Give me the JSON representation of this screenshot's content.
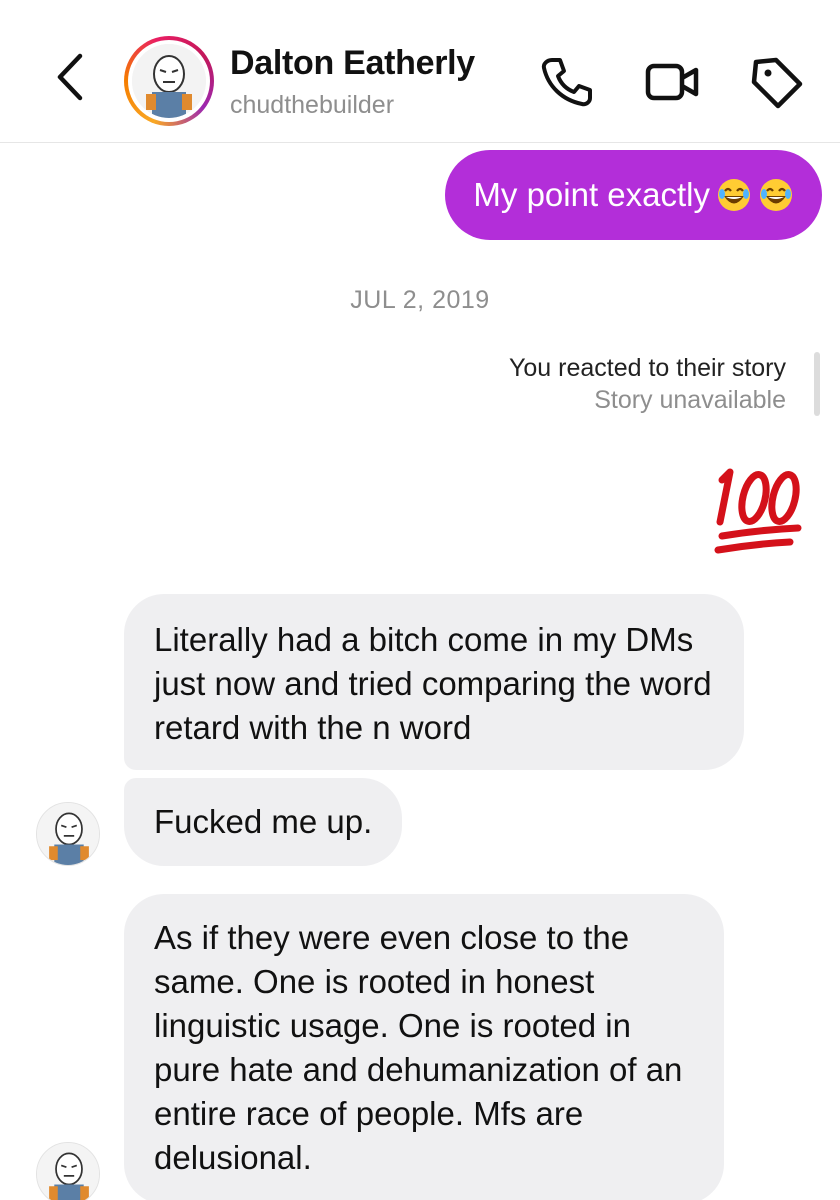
{
  "header": {
    "contact_name": "Dalton Eatherly",
    "contact_handle": "chudthebuilder",
    "icons": [
      "back-chevron-icon",
      "phone-icon",
      "video-camera-icon",
      "tag-icon"
    ]
  },
  "messages": {
    "outgoing_1": {
      "text": "My point exactly",
      "emoji": "😂😂"
    },
    "date_separator": "JUL 2, 2019",
    "story_reaction": {
      "title": "You reacted to their story",
      "subtitle": "Story unavailable",
      "reaction_emoji": "💯"
    },
    "incoming_1": "Literally had a bitch come in my DMs just now and tried comparing the word retard with the n word",
    "incoming_2": "Fucked me up.",
    "incoming_3": "As if they were even close to the same. One is rooted in honest linguistic usage. One is rooted in pure hate and dehumanization of an entire race of people. Mfs are delusional."
  },
  "colors": {
    "outgoing_bubble": "#b32ed9",
    "incoming_bubble": "#efeff1",
    "secondary_text": "#8e8e8e",
    "reaction_red": "#d4111a"
  }
}
